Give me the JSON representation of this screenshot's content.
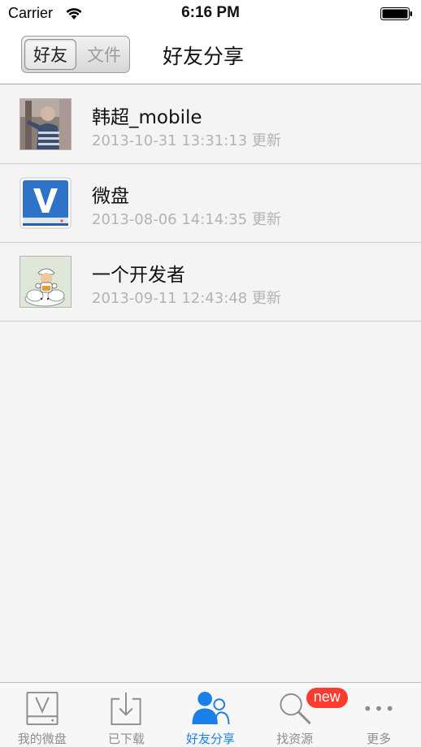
{
  "status_bar": {
    "carrier": "Carrier",
    "time": "6:16 PM"
  },
  "nav": {
    "segments": [
      "好友",
      "文件"
    ],
    "selected_segment": "好友",
    "title": "好友分享"
  },
  "list": {
    "items": [
      {
        "name": "韩超_mobile",
        "subtitle": "2013-10-31 13:31:13 更新",
        "avatar_icon": "photo-avatar-icon"
      },
      {
        "name": "微盘",
        "subtitle": "2013-08-06 14:14:35 更新",
        "avatar_icon": "vdisk-logo-icon"
      },
      {
        "name": "一个开发者",
        "subtitle": "2013-09-11 12:43:48 更新",
        "avatar_icon": "mario-avatar-icon"
      }
    ]
  },
  "tab_bar": {
    "tabs": [
      {
        "label": "我的微盘",
        "icon": "vdisk-drive-icon"
      },
      {
        "label": "已下载",
        "icon": "download-tray-icon"
      },
      {
        "label": "好友分享",
        "icon": "friends-icon",
        "active": true
      },
      {
        "label": "找资源",
        "icon": "search-icon",
        "badge": "new"
      },
      {
        "label": "更多",
        "icon": "more-dots-icon"
      }
    ]
  },
  "colors": {
    "accent": "#1a7fe8",
    "badge": "#ff3b30",
    "subtitle_gray": "#b3b3b3"
  }
}
